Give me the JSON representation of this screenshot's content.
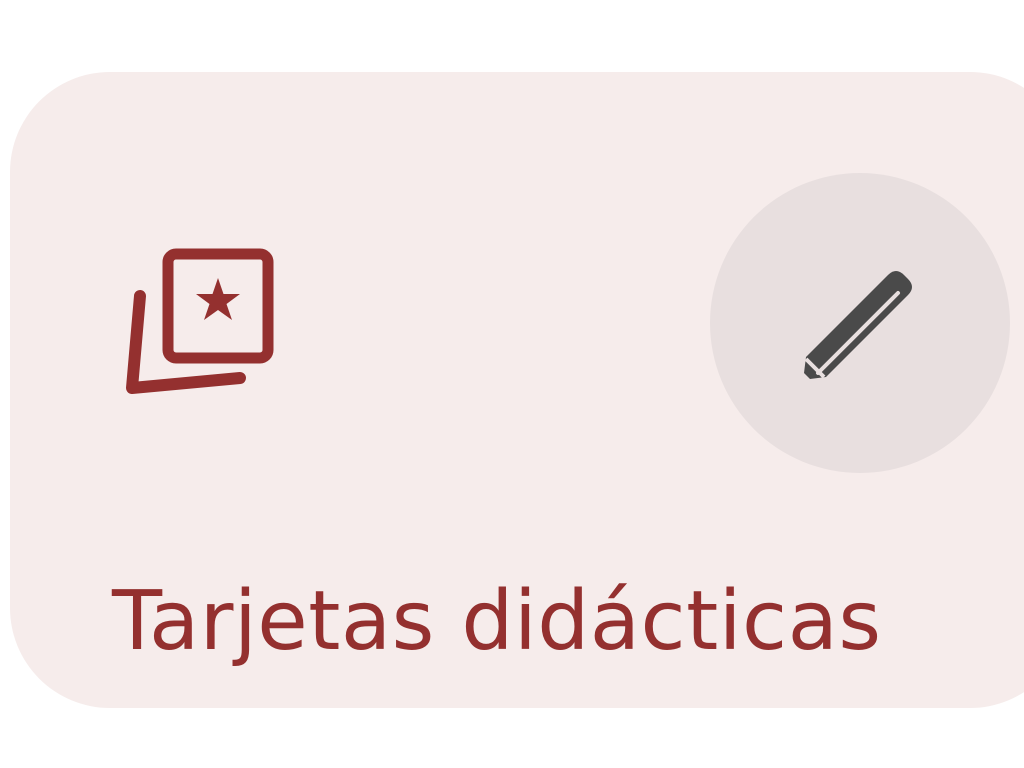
{
  "card": {
    "label": "Tarjetas didácticas",
    "icon": "flashcards-star-icon",
    "edit_icon": "pencil-icon"
  },
  "colors": {
    "card_background": "#f6eceb",
    "accent": "#94302f",
    "edit_button_background": "#e8dfdf",
    "edit_icon": "#4a4a4a"
  }
}
